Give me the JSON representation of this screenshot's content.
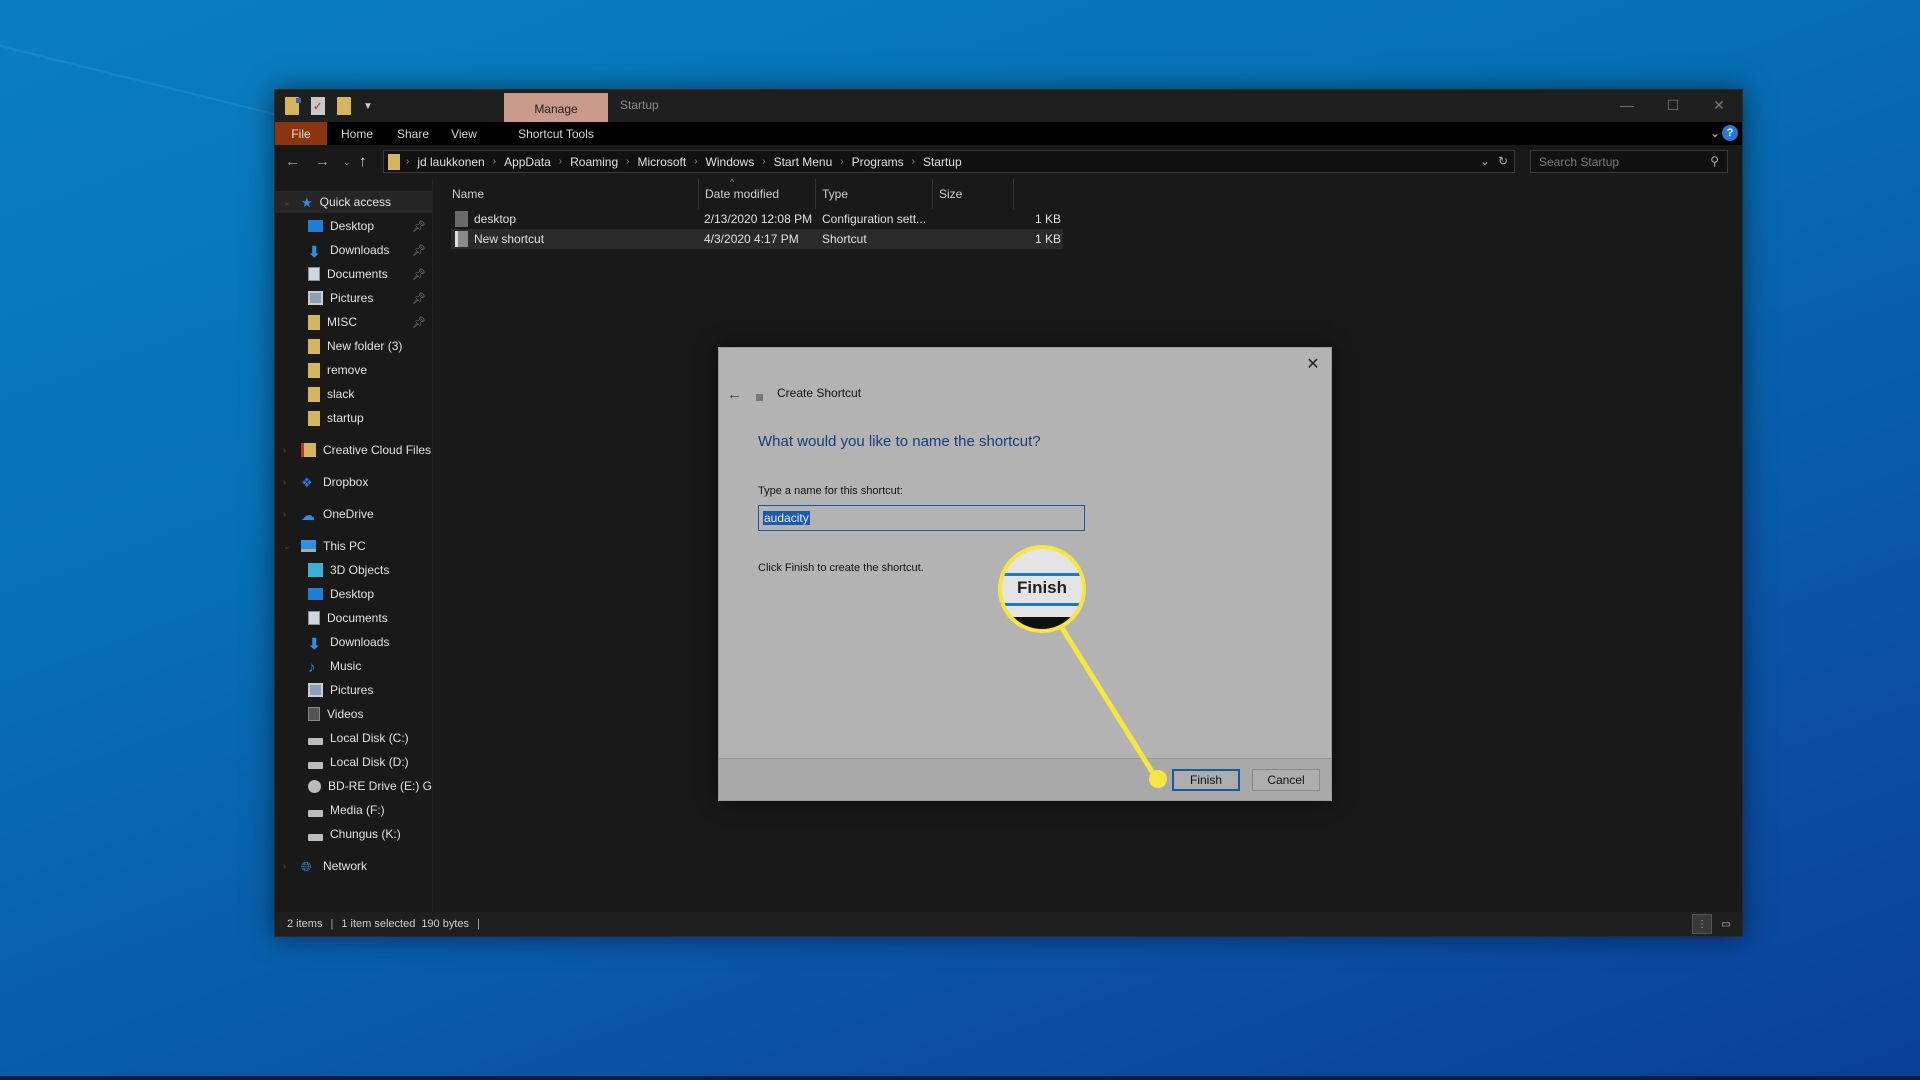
{
  "window": {
    "title": "Startup",
    "contextual_tab": "Manage",
    "qat_icons": [
      "properties-folder-icon",
      "checkmark-icon",
      "new-folder-icon",
      "customize-dropdown-icon"
    ],
    "controls": {
      "minimize": "—",
      "maximize": "☐",
      "close": "✕"
    }
  },
  "ribbon": {
    "tabs": [
      "File",
      "Home",
      "Share",
      "View",
      "Shortcut Tools"
    ],
    "active_tab": "File",
    "accent_color": "#8a3510",
    "manage_color": "#c9998a"
  },
  "address_bar": {
    "breadcrumbs": [
      "jd laukkonen",
      "AppData",
      "Roaming",
      "Microsoft",
      "Windows",
      "Start Menu",
      "Programs",
      "Startup"
    ]
  },
  "search": {
    "placeholder": "Search Startup"
  },
  "sidebar": {
    "quick_access": {
      "label": "Quick access",
      "items": [
        {
          "label": "Desktop",
          "icon": "desktop",
          "pinned": true
        },
        {
          "label": "Downloads",
          "icon": "downloads",
          "pinned": true
        },
        {
          "label": "Documents",
          "icon": "documents",
          "pinned": true
        },
        {
          "label": "Pictures",
          "icon": "pictures",
          "pinned": true
        },
        {
          "label": "MISC",
          "icon": "folder",
          "pinned": true
        },
        {
          "label": "New folder (3)",
          "icon": "folder",
          "pinned": false
        },
        {
          "label": "remove",
          "icon": "folder",
          "pinned": false
        },
        {
          "label": "slack",
          "icon": "folder",
          "pinned": false
        },
        {
          "label": "startup",
          "icon": "folder",
          "pinned": false
        }
      ]
    },
    "roots": [
      {
        "label": "Creative Cloud Files",
        "icon": "creative-cloud"
      },
      {
        "label": "Dropbox",
        "icon": "dropbox"
      },
      {
        "label": "OneDrive",
        "icon": "onedrive"
      }
    ],
    "this_pc": {
      "label": "This PC",
      "items": [
        {
          "label": "3D Objects",
          "icon": "3d-objects"
        },
        {
          "label": "Desktop",
          "icon": "desktop"
        },
        {
          "label": "Documents",
          "icon": "documents"
        },
        {
          "label": "Downloads",
          "icon": "downloads"
        },
        {
          "label": "Music",
          "icon": "music"
        },
        {
          "label": "Pictures",
          "icon": "pictures"
        },
        {
          "label": "Videos",
          "icon": "videos"
        },
        {
          "label": "Local Disk (C:)",
          "icon": "drive"
        },
        {
          "label": "Local Disk (D:)",
          "icon": "drive"
        },
        {
          "label": "BD-RE Drive (E:) GG",
          "icon": "disc"
        },
        {
          "label": "Media (F:)",
          "icon": "drive"
        },
        {
          "label": "Chungus (K:)",
          "icon": "drive"
        }
      ]
    },
    "network": {
      "label": "Network"
    }
  },
  "file_list": {
    "columns": [
      "Name",
      "Date modified",
      "Type",
      "Size"
    ],
    "rows": [
      {
        "name": "desktop",
        "date": "2/13/2020 12:08 PM",
        "type": "Configuration sett...",
        "size": "1 KB",
        "selected": false
      },
      {
        "name": "New shortcut",
        "date": "4/3/2020 4:17 PM",
        "type": "Shortcut",
        "size": "1 KB",
        "selected": true
      }
    ]
  },
  "status_bar": {
    "item_count": "2 items",
    "selection": "1 item selected",
    "size": "190 bytes"
  },
  "dialog": {
    "title": "Create Shortcut",
    "heading": "What would you like to name the shortcut?",
    "field_label": "Type a name for this shortcut:",
    "field_value": "audacity",
    "info": "Click Finish to create the shortcut.",
    "finish_label": "Finish",
    "cancel_label": "Cancel",
    "heading_color": "#1b3c78"
  },
  "annotation": {
    "callout_label": "Finish",
    "color": "#f5e642"
  }
}
